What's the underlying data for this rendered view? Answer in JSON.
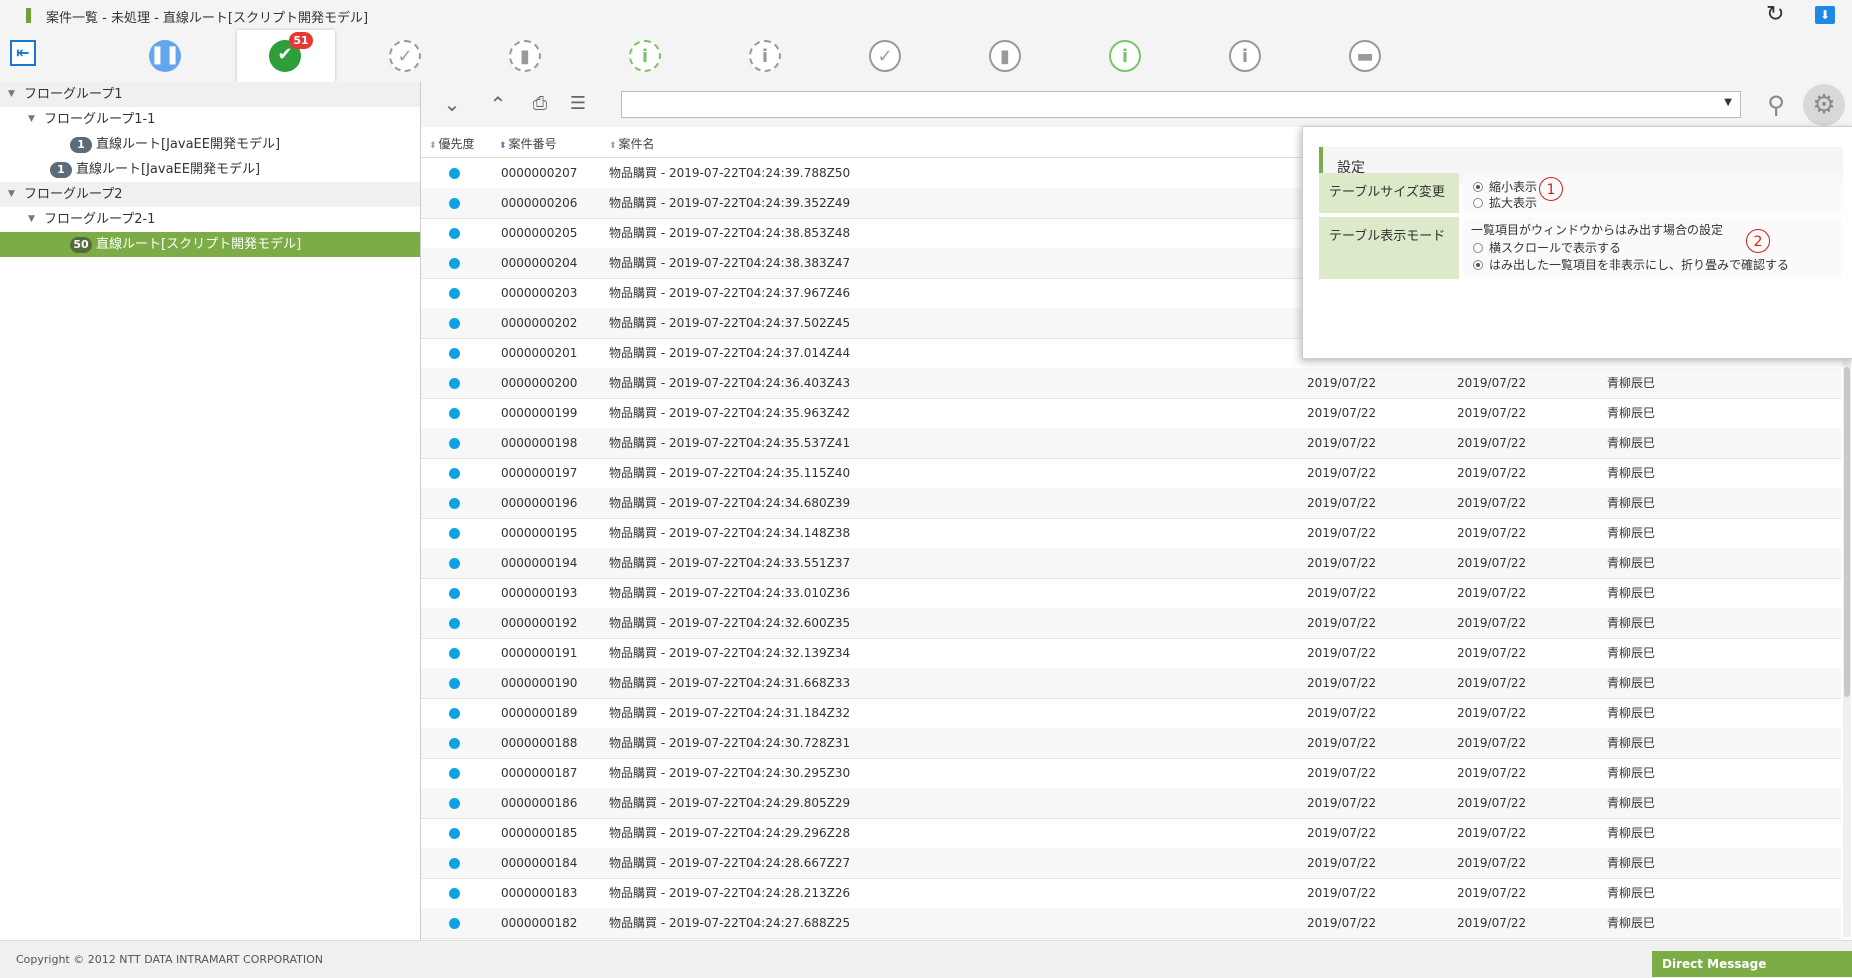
{
  "window": {
    "title": "案件一覧 - 未処理 - 直線ルート[スクリプト開発モデル]"
  },
  "tabs": [
    {
      "name": "pause",
      "glyph": "❚❚",
      "color": "#64a5ef",
      "style": "filled",
      "active": false
    },
    {
      "name": "check",
      "glyph": "✔",
      "color": "#2e9e3a",
      "style": "filled",
      "active": true,
      "badge": "51"
    },
    {
      "name": "check-outline",
      "glyph": "✓",
      "color": "#999999",
      "style": "dashed",
      "active": false
    },
    {
      "name": "trash-outline",
      "glyph": "▮",
      "color": "#999999",
      "style": "dashed",
      "active": false
    },
    {
      "name": "info-outline-green",
      "glyph": "i",
      "color": "#7cc36a",
      "style": "dashed",
      "active": false
    },
    {
      "name": "info-outline",
      "glyph": "i",
      "color": "#999999",
      "style": "dashed",
      "active": false
    },
    {
      "name": "check-solid",
      "glyph": "✓",
      "color": "#999999",
      "style": "solid",
      "active": false
    },
    {
      "name": "trash-solid",
      "glyph": "▮",
      "color": "#999999",
      "style": "solid",
      "active": false
    },
    {
      "name": "info-solid-green",
      "glyph": "i",
      "color": "#7cc36a",
      "style": "solid",
      "active": false
    },
    {
      "name": "info-solid",
      "glyph": "i",
      "color": "#999999",
      "style": "solid",
      "active": false
    },
    {
      "name": "folder",
      "glyph": "▬",
      "color": "#999999",
      "style": "solid",
      "active": false
    }
  ],
  "tree": [
    {
      "label": "フローグループ1",
      "kind": "group",
      "level": 0
    },
    {
      "label": "フローグループ1-1",
      "kind": "subgroup",
      "level": 1
    },
    {
      "label": "直線ルート[JavaEE開発モデル]",
      "kind": "item",
      "level": 2,
      "count": "1"
    },
    {
      "label": "直線ルート[JavaEE開発モデル]",
      "kind": "item",
      "level": 1,
      "count": "1"
    },
    {
      "label": "フローグループ2",
      "kind": "group",
      "level": 0
    },
    {
      "label": "フローグループ2-1",
      "kind": "subgroup",
      "level": 1
    },
    {
      "label": "直線ルート[スクリプト開発モデル]",
      "kind": "item",
      "level": 2,
      "count": "50",
      "selected": true
    }
  ],
  "table": {
    "headers": {
      "priority": "優先度",
      "number": "案件番号",
      "name": "案件名"
    },
    "rows": [
      {
        "number": "0000000207",
        "name": "物品購買 - 2019-07-22T04:24:39.788Z50",
        "date1": "",
        "date2": "",
        "user": ""
      },
      {
        "number": "0000000206",
        "name": "物品購買 - 2019-07-22T04:24:39.352Z49",
        "date1": "",
        "date2": "",
        "user": ""
      },
      {
        "number": "0000000205",
        "name": "物品購買 - 2019-07-22T04:24:38.853Z48",
        "date1": "",
        "date2": "",
        "user": ""
      },
      {
        "number": "0000000204",
        "name": "物品購買 - 2019-07-22T04:24:38.383Z47",
        "date1": "",
        "date2": "",
        "user": ""
      },
      {
        "number": "0000000203",
        "name": "物品購買 - 2019-07-22T04:24:37.967Z46",
        "date1": "",
        "date2": "",
        "user": ""
      },
      {
        "number": "0000000202",
        "name": "物品購買 - 2019-07-22T04:24:37.502Z45",
        "date1": "",
        "date2": "",
        "user": ""
      },
      {
        "number": "0000000201",
        "name": "物品購買 - 2019-07-22T04:24:37.014Z44",
        "date1": "",
        "date2": "",
        "user": ""
      },
      {
        "number": "0000000200",
        "name": "物品購買 - 2019-07-22T04:24:36.403Z43",
        "date1": "2019/07/22",
        "date2": "2019/07/22",
        "user": "青柳辰巳"
      },
      {
        "number": "0000000199",
        "name": "物品購買 - 2019-07-22T04:24:35.963Z42",
        "date1": "2019/07/22",
        "date2": "2019/07/22",
        "user": "青柳辰巳"
      },
      {
        "number": "0000000198",
        "name": "物品購買 - 2019-07-22T04:24:35.537Z41",
        "date1": "2019/07/22",
        "date2": "2019/07/22",
        "user": "青柳辰巳"
      },
      {
        "number": "0000000197",
        "name": "物品購買 - 2019-07-22T04:24:35.115Z40",
        "date1": "2019/07/22",
        "date2": "2019/07/22",
        "user": "青柳辰巳"
      },
      {
        "number": "0000000196",
        "name": "物品購買 - 2019-07-22T04:24:34.680Z39",
        "date1": "2019/07/22",
        "date2": "2019/07/22",
        "user": "青柳辰巳"
      },
      {
        "number": "0000000195",
        "name": "物品購買 - 2019-07-22T04:24:34.148Z38",
        "date1": "2019/07/22",
        "date2": "2019/07/22",
        "user": "青柳辰巳"
      },
      {
        "number": "0000000194",
        "name": "物品購買 - 2019-07-22T04:24:33.551Z37",
        "date1": "2019/07/22",
        "date2": "2019/07/22",
        "user": "青柳辰巳"
      },
      {
        "number": "0000000193",
        "name": "物品購買 - 2019-07-22T04:24:33.010Z36",
        "date1": "2019/07/22",
        "date2": "2019/07/22",
        "user": "青柳辰巳"
      },
      {
        "number": "0000000192",
        "name": "物品購買 - 2019-07-22T04:24:32.600Z35",
        "date1": "2019/07/22",
        "date2": "2019/07/22",
        "user": "青柳辰巳"
      },
      {
        "number": "0000000191",
        "name": "物品購買 - 2019-07-22T04:24:32.139Z34",
        "date1": "2019/07/22",
        "date2": "2019/07/22",
        "user": "青柳辰巳"
      },
      {
        "number": "0000000190",
        "name": "物品購買 - 2019-07-22T04:24:31.668Z33",
        "date1": "2019/07/22",
        "date2": "2019/07/22",
        "user": "青柳辰巳"
      },
      {
        "number": "0000000189",
        "name": "物品購買 - 2019-07-22T04:24:31.184Z32",
        "date1": "2019/07/22",
        "date2": "2019/07/22",
        "user": "青柳辰巳"
      },
      {
        "number": "0000000188",
        "name": "物品購買 - 2019-07-22T04:24:30.728Z31",
        "date1": "2019/07/22",
        "date2": "2019/07/22",
        "user": "青柳辰巳"
      },
      {
        "number": "0000000187",
        "name": "物品購買 - 2019-07-22T04:24:30.295Z30",
        "date1": "2019/07/22",
        "date2": "2019/07/22",
        "user": "青柳辰巳"
      },
      {
        "number": "0000000186",
        "name": "物品購買 - 2019-07-22T04:24:29.805Z29",
        "date1": "2019/07/22",
        "date2": "2019/07/22",
        "user": "青柳辰巳"
      },
      {
        "number": "0000000185",
        "name": "物品購買 - 2019-07-22T04:24:29.296Z28",
        "date1": "2019/07/22",
        "date2": "2019/07/22",
        "user": "青柳辰巳"
      },
      {
        "number": "0000000184",
        "name": "物品購買 - 2019-07-22T04:24:28.667Z27",
        "date1": "2019/07/22",
        "date2": "2019/07/22",
        "user": "青柳辰巳"
      },
      {
        "number": "0000000183",
        "name": "物品購買 - 2019-07-22T04:24:28.213Z26",
        "date1": "2019/07/22",
        "date2": "2019/07/22",
        "user": "青柳辰巳"
      },
      {
        "number": "0000000182",
        "name": "物品購買 - 2019-07-22T04:24:27.688Z25",
        "date1": "2019/07/22",
        "date2": "2019/07/22",
        "user": "青柳辰巳"
      }
    ]
  },
  "settings": {
    "title": "設定",
    "size_label": "テーブルサイズ変更",
    "size_opt_small": "縮小表示",
    "size_opt_large": "拡大表示",
    "size_selected": "small",
    "mode_label": "テーブル表示モード",
    "mode_desc": "一覧項目がウィンドウからはみ出す場合の設定",
    "mode_opt_scroll": "横スクロールで表示する",
    "mode_opt_fold": "はみ出した一覧項目を非表示にし、折り畳みで確認する",
    "mode_selected": "fold",
    "callout_1": "1",
    "callout_2": "2"
  },
  "footer": {
    "copyright": "Copyright © 2012 NTT DATA INTRAMART CORPORATION"
  },
  "direct_message": {
    "label": "Direct Message"
  },
  "colors": {
    "accent_green": "#7cac45",
    "priority_dot": "#0fa2e3",
    "badge_red": "#e53935"
  }
}
